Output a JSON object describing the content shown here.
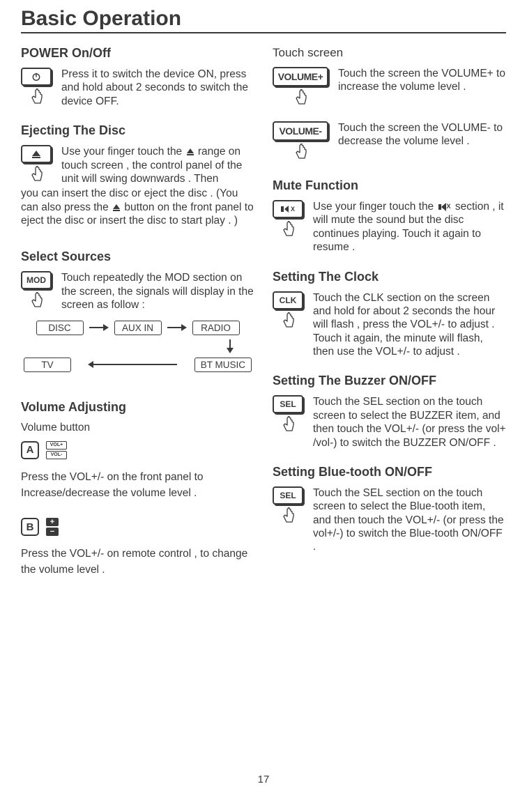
{
  "pageTitle": "Basic Operation",
  "pageNumber": "17",
  "left": {
    "power": {
      "title": "POWER On/Off",
      "text": "Press it to switch the device ON, press and hold about 2 seconds to switch the device OFF."
    },
    "eject": {
      "title": "Ejecting The Disc",
      "text1": "Use your finger touch the",
      "text2": "range on touch screen , the control panel of the unit will swing downwards . Then",
      "text3": "you can insert the disc or eject the disc . (You can also press the",
      "text4": "button on the front panel to eject the disc or insert the disc to start play . )"
    },
    "sources": {
      "title": "Select Sources",
      "btn": "MOD",
      "text": "Touch repeatedly the MOD section on the screen,  the signals will display in the screen as follow :",
      "flow": {
        "disc": "DISC",
        "aux": "AUX IN",
        "radio": "RADIO",
        "tv": "TV",
        "bt": "BT MUSIC"
      }
    },
    "volume": {
      "title": "Volume Adjusting",
      "sub": "Volume button",
      "a": "A",
      "aVolPlus": "VOL+",
      "aVolMinus": "VOL-",
      "aText": "Press the VOL+/- on the front panel  to Increase/decrease the volume level .",
      "b": "B",
      "bPlus": "+",
      "bMinus": "−",
      "bText": "Press the VOL+/- on remote control , to change the volume level ."
    }
  },
  "right": {
    "touch": {
      "title": "Touch screen",
      "volPlusBtn": "VOLUME+",
      "volPlusText": "Touch the screen the VOLUME+ to increase the volume level .",
      "volMinusBtn": "VOLUME-",
      "volMinusText": "Touch the screen the VOLUME- to decrease the volume level ."
    },
    "mute": {
      "title": "Mute Function",
      "text1": "Use your finger touch the",
      "text2": "section , it will mute the sound but the disc continues playing. Touch it again to resume ."
    },
    "clock": {
      "title": "Setting The Clock",
      "btn": "CLK",
      "text": "Touch the CLK section on the screen and hold for about 2 seconds the hour will flash , press the VOL+/- to adjust . Touch it again, the minute will flash, then use the VOL+/- to adjust ."
    },
    "buzzer": {
      "title": "Setting The Buzzer ON/OFF",
      "btn": "SEL",
      "text": "Touch the SEL section on the touch screen to select the BUZZER item, and then touch the VOL+/- (or press the vol+ /vol-)  to switch the BUZZER ON/OFF ."
    },
    "bt": {
      "title": "Setting Blue-tooth ON/OFF",
      "btn": "SEL",
      "text": "Touch the SEL section on the touch screen to select the Blue-tooth item, and then touch the VOL+/- (or press the vol+/-) to switch the Blue-tooth ON/OFF ."
    }
  }
}
